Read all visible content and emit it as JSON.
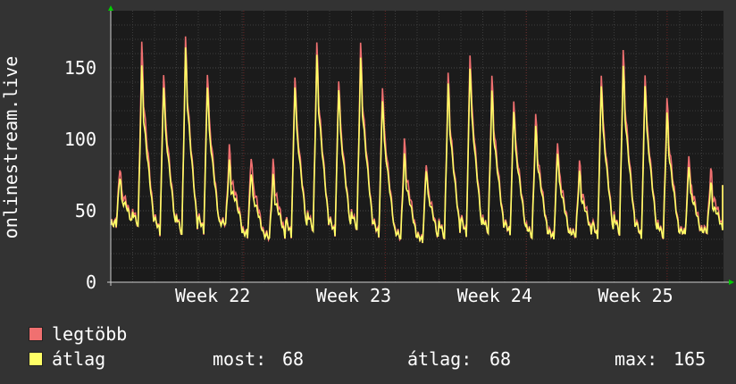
{
  "chart_data": {
    "type": "line",
    "ylabel": "onlinestream.live",
    "ylim": [
      0,
      190
    ],
    "y_ticks": [
      0,
      50,
      100,
      150
    ],
    "x_ticks": [
      "Week 22",
      "Week 23",
      "Week 24",
      "Week 25"
    ],
    "x_tick_positions": [
      0.105,
      0.335,
      0.565,
      0.795
    ],
    "grid": true,
    "colors": {
      "max": "#f07070",
      "avg": "#ffff66",
      "plot_bg": "#1b1b1b",
      "grid": "#3c3c3c",
      "vgrid": "#6b2424",
      "axis": "#cccccc",
      "arrow": "#00cc00"
    },
    "day_peaks_max": [
      82,
      168,
      150,
      172,
      150,
      95,
      90,
      85,
      148,
      168,
      145,
      168,
      140,
      100,
      85,
      147,
      163,
      145,
      130,
      118,
      100,
      85,
      148,
      164,
      148,
      130,
      90,
      80
    ],
    "day_peaks_avg": [
      75,
      152,
      140,
      165,
      140,
      85,
      78,
      75,
      140,
      160,
      138,
      158,
      130,
      90,
      80,
      140,
      153,
      135,
      122,
      110,
      92,
      78,
      140,
      153,
      140,
      120,
      82,
      70
    ],
    "day_min": [
      40,
      38,
      34,
      32,
      35,
      40,
      32,
      30,
      32,
      35,
      33,
      36,
      32,
      30,
      28,
      30,
      32,
      34,
      33,
      31,
      30,
      32,
      30,
      33,
      30,
      31,
      33,
      35
    ],
    "series": [
      {
        "name": "legtöbb",
        "color": "#f07070"
      },
      {
        "name": "átlag",
        "color": "#ffff66"
      }
    ]
  },
  "legend": {
    "max_label": "legtöbb",
    "avg_label": "átlag",
    "current_label": "most:",
    "current_value": "68",
    "average_label": "átlag:",
    "average_value": "68",
    "max_stat_label": "max:",
    "max_stat_value": "165"
  }
}
